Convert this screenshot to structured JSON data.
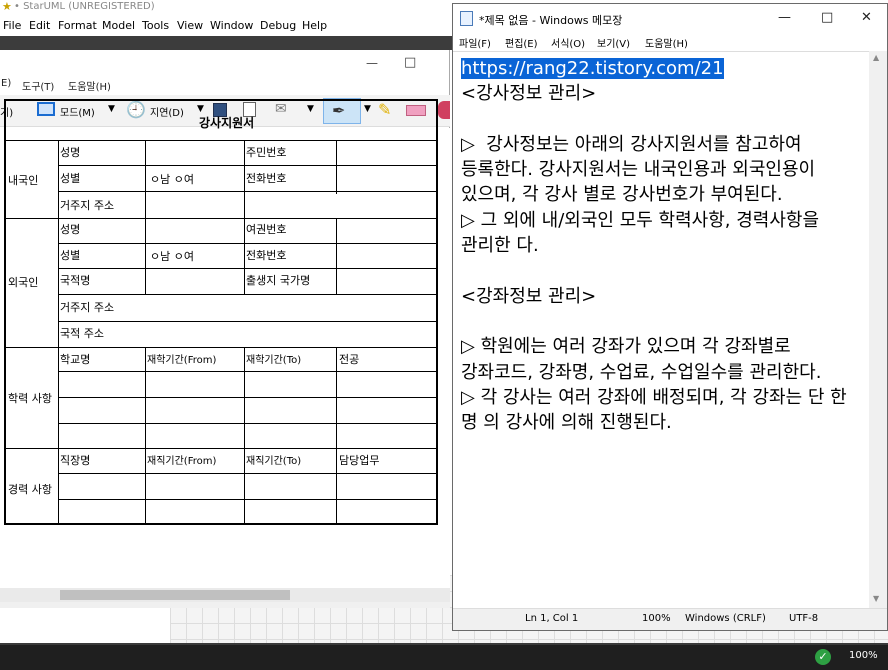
{
  "staruml": {
    "title": "• StarUML (UNREGISTERED)",
    "menu": [
      "File",
      "Edit",
      "Format",
      "Model",
      "Tools",
      "View",
      "Window",
      "Debug",
      "Help"
    ]
  },
  "paint": {
    "menu": [
      "E)",
      "도구(T)",
      "도움말(H)"
    ],
    "tools": {
      "mode_prefix": "기)",
      "mode": "모드(M)",
      "delay": "지연(D)"
    },
    "win_controls": {
      "minimize": "—",
      "maximize": "□"
    }
  },
  "form": {
    "title": "강사지원서",
    "sections": {
      "domestic": "내국인",
      "foreign": "외국인",
      "education": "학력 사항",
      "career": "경력 사항"
    },
    "labels": {
      "name": "성명",
      "resident_no": "주민번호",
      "gender": "성별",
      "gender_options": "ㅇ남   ㅇ여",
      "phone": "전화번호",
      "address": "거주지 주소",
      "passport": "여권번호",
      "nationality": "국적명",
      "birth_country": "출생지 국가명",
      "nation_address": "국적 주소",
      "school": "학교명",
      "study_from": "재학기간(From)",
      "study_to": "재학기간(To)",
      "major": "전공",
      "job": "직장명",
      "work_from": "재직기간(From)",
      "work_to": "재직기간(To)",
      "duty": "담당업무"
    }
  },
  "notepad": {
    "title": "*제목 없음 - Windows 메모장",
    "menu": [
      "파일(F)",
      "편집(E)",
      "서식(O)",
      "보기(V)",
      "도움말(H)"
    ],
    "win_controls": {
      "minimize": "—",
      "maximize": "□",
      "close": "✕"
    },
    "selected_text": "https://rang22.tistory.com/21",
    "body_text": "\n<강사정보 관리>\n\n▷  강사정보는 아래의 강사지원서를 참고하여 등록한다. 강사지원서는 내국인용과 외국인용이 있으며, 각 강사 별로 강사번호가 부여된다.\n▷ 그 외에 내/외국인 모두 학력사항, 경력사항을 관리한 다.\n\n<강좌정보 관리>\n\n▷ 학원에는 여러 강좌가 있으며 각 강좌별로 강좌코드, 강좌명, 수업료, 수업일수를 관리한다.\n▷ 각 강사는 여러 강좌에 배정되며, 각 강좌는 단 한 명 의 강사에 의해 진행된다.",
    "status": {
      "position": "Ln 1, Col 1",
      "zoom": "100%",
      "eol": "Windows (CRLF)",
      "encoding": "UTF-8"
    }
  },
  "taskbar": {
    "zoom": "100%"
  },
  "colors": {
    "selection": "#0a64d6",
    "taskbar": "#1f1f1f",
    "strip": "#3c3c3c",
    "ok_icon": "#2ea043"
  }
}
